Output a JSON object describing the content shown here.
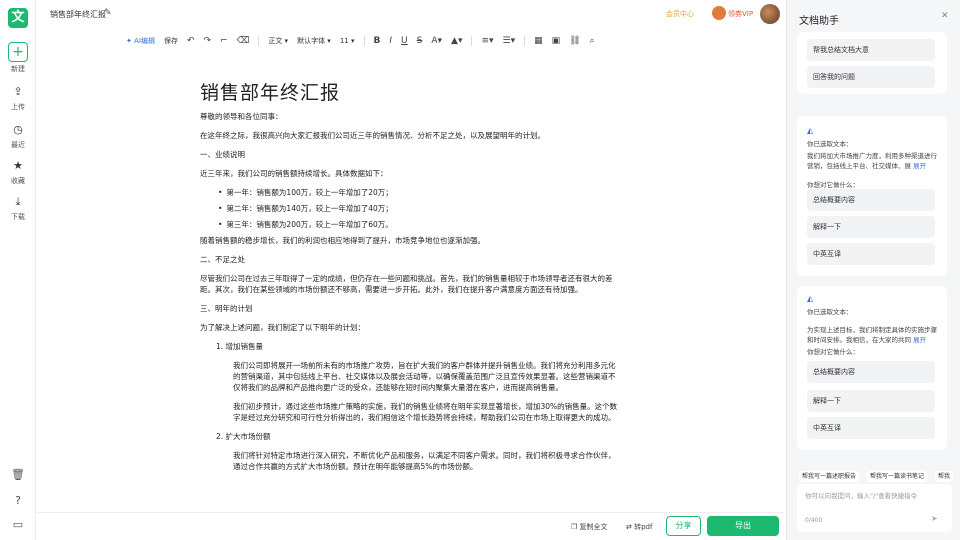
{
  "rail": {
    "new": "新建",
    "upload": "上传",
    "recent": "最近",
    "favorites": "收藏",
    "download": "下载",
    "logo": "文"
  },
  "topbar": {
    "doc_name": "销售部年终汇报",
    "member": "会员中心",
    "vip": "领券VIP"
  },
  "toolbar": {
    "ai": "AI编辑",
    "save": "保存",
    "style": "正文",
    "font": "默认字体",
    "size": "11"
  },
  "doc": {
    "title": "销售部年终汇报",
    "greeting": "尊敬的领导和各位同事：",
    "intro": "在这年终之际，我很高兴向大家汇报我们公司近三年的销售情况、分析不足之处，以及展望明年的计划。",
    "s1": "一、业绩说明",
    "s1_p": "近三年来，我们公司的销售额持续增长。具体数据如下：",
    "s1_items": [
      "第一年：销售额为100万，较上一年增加了20万；",
      "第二年：销售额为140万，较上一年增加了40万；",
      "第三年：销售额为200万，较上一年增加了60万。"
    ],
    "s1_end": "随着销售额的稳步增长，我们的利润也相应地得到了提升，市场竞争地位也逐渐加强。",
    "s2": "二、不足之处",
    "s2_p": "尽管我们公司在过去三年取得了一定的成绩，但仍存在一些问题和挑战。首先，我们的销售量相较于市场领导者还有很大的差距。其次，我们在某些领域的市场份额还不够高，需要进一步开拓。此外，我们在提升客户满意度方面还有待加强。",
    "s3": "三、明年的计划",
    "s3_p": "为了解决上述问题，我们制定了以下明年的计划：",
    "plan1": "1. 增加销售量",
    "plan1_a": "我们公司即将展开一场前所未有的市场推广攻势，旨在扩大我们的客户群体并提升销售业绩。我们将充分利用多元化的营销渠道，其中包括线上平台、社交媒体以及展会活动等，以确保覆盖范围广泛且宣传效果显著。这些营销渠道不仅将我们的品牌和产品推向更广泛的受众，还能够在短时间内聚集大量潜在客户，进而提高销售量。",
    "plan1_b": "我们初步预计，通过这些市场推广策略的实施，我们的销售业绩将在明年实现显著增长，增加30%的销售量。这个数字是经过充分研究和可行性分析得出的，我们相信这个增长趋势将会持续，帮助我们公司在市场上取得更大的成功。",
    "plan2": "2. 扩大市场份额",
    "plan2_a": "我们将针对特定市场进行深入研究，不断优化产品和服务，以满足不同客户需求。同时，我们将积极寻求合作伙伴，通过合作共赢的方式扩大市场份额。预计在明年能够提高5%的市场份额。"
  },
  "bottom": {
    "copy": "复制全文",
    "pdf": "转pdf",
    "share": "分享",
    "export": "导出"
  },
  "assistant": {
    "title": "文档助手",
    "chip1": "帮我总结文档大意",
    "chip2": "回答我的问题",
    "sel_label": "你已选取文本：",
    "sel1": "我们将加大市场推广力度，利用多种渠道进行营销，包括线上平台、社交媒体、展",
    "sel2": "为实现上述目标，我们将制定具体的实施步骤和时间安排。我相信，在大家的共同",
    "expand": "展开",
    "ask": "你想对它做什么：",
    "opt1": "总结概要内容",
    "opt2": "解释一下",
    "opt3": "中英互译",
    "quick1": "帮我写一篇述职报告",
    "quick2": "帮我写一篇读书笔记",
    "quick3": "帮我",
    "input_placeholder": "你可以向我提问，输入\"/\"查看快捷指令",
    "counter": "0/400"
  }
}
